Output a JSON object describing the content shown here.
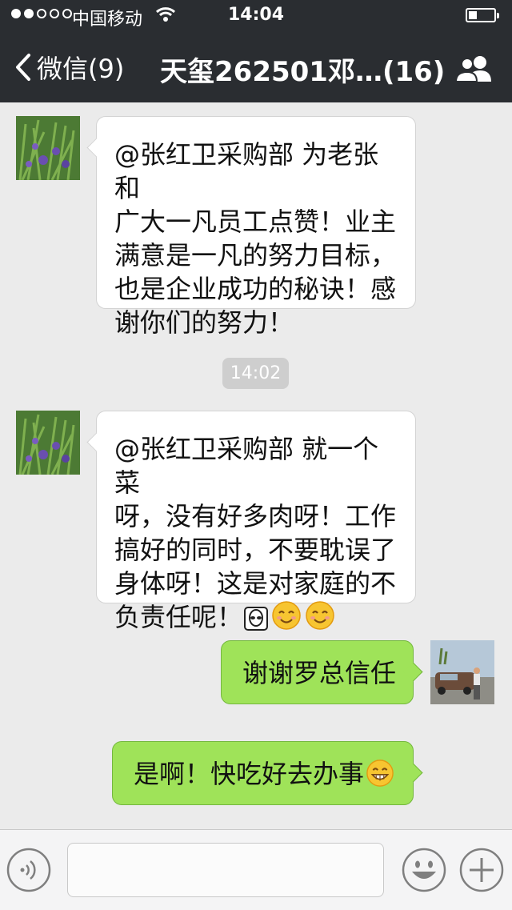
{
  "status_bar": {
    "carrier": "中国移动",
    "time": "14:04",
    "signal_bars_filled": 2,
    "signal_bars_total": 5,
    "battery_level": 0.3
  },
  "nav": {
    "back_label": "微信(9)",
    "title": "天玺262501邓…(16)"
  },
  "messages": [
    {
      "side": "left",
      "text": "@张红卫采购部 为老张和\n广大一凡员工点赞！业主\n满意是一凡的努力目标，\n也是企业成功的秘诀！感\n谢你们的努力！"
    },
    {
      "side": "left",
      "text": "@张红卫采购部 就一个菜\n呀，没有好多肉呀！工作\n搞好的同时，不要耽误了\n身体呀！这是对家庭的不\n负责任呢！"
    },
    {
      "side": "right",
      "text": "谢谢罗总信任"
    },
    {
      "side": "right",
      "text": "是啊！快吃好去办事"
    }
  ],
  "timestamp_divider": "14:02",
  "icons": {
    "back": "chevron-left-icon",
    "members": "group-members-icon",
    "voice": "voice-input-icon",
    "emoji": "emoji-icon",
    "plus": "plus-icon",
    "alien": "alien-emoji-icon",
    "smile": "smile-emoji-icon",
    "grin": "grin-emoji-icon"
  },
  "colors": {
    "header_bg": "#2a2d31",
    "chat_bg": "#ebebeb",
    "sent_bubble": "#9fe359",
    "received_bubble": "#ffffff"
  }
}
